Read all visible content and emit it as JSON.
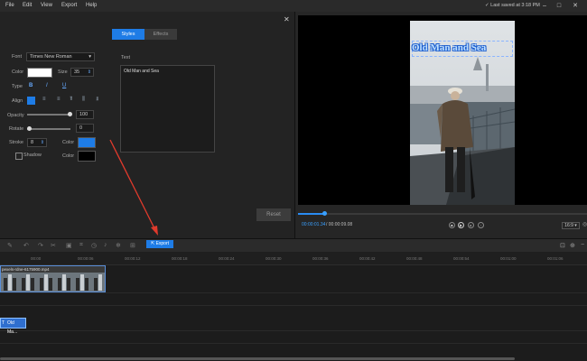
{
  "menu": [
    "File",
    "Edit",
    "View",
    "Export",
    "Help"
  ],
  "autosave": "Last saved at 3:18 PM",
  "panel": {
    "tabs": [
      "Styles",
      "Effects"
    ],
    "font_label": "Font",
    "font_value": "Times New Roman",
    "color_label": "Color",
    "size_label": "Size",
    "size_value": "35",
    "type_label": "Type",
    "type_buttons": [
      "B",
      "I",
      "U"
    ],
    "align_label": "Align",
    "opacity_label": "Opacity",
    "opacity_value": "100",
    "rotate_label": "Rotate",
    "rotate_value": "0",
    "stroke_label": "Stroke",
    "stroke_value": "8",
    "stroke_color_label": "Color",
    "shadow_label": "Shadow",
    "shadow_color_label": "Color",
    "text_label": "Text",
    "text_value": "Old Man and Sea",
    "reset_label": "Reset",
    "opacity_level": 1.0,
    "rotate_level": 0.0
  },
  "preview": {
    "overlay_text": "Old Man and Sea",
    "time_current": "00:00:01.34",
    "time_total": "/ 00:00:09.08",
    "ratio": "16:9",
    "progress": 0.09
  },
  "toolbar": {
    "export_label": "Export"
  },
  "timeline": {
    "ticks": [
      "00:00",
      "00:00:06",
      "00:00:12",
      "00:00:18",
      "00:00:24",
      "00:00:30",
      "00:00:36",
      "00:00:42",
      "00:00:48",
      "00:00:54",
      "00:01:00",
      "00:01:06"
    ],
    "video_clip_name": "pexels-rdne-6175900.mp4",
    "text_clip_name": "Old Ma..."
  },
  "colors": {
    "accent": "#1e7ce6",
    "text_color_swatch": "#ffffff",
    "stroke_color_swatch": "#1e7ce6",
    "shadow_color_swatch": "#000000",
    "arrow": "#e03a2c"
  }
}
